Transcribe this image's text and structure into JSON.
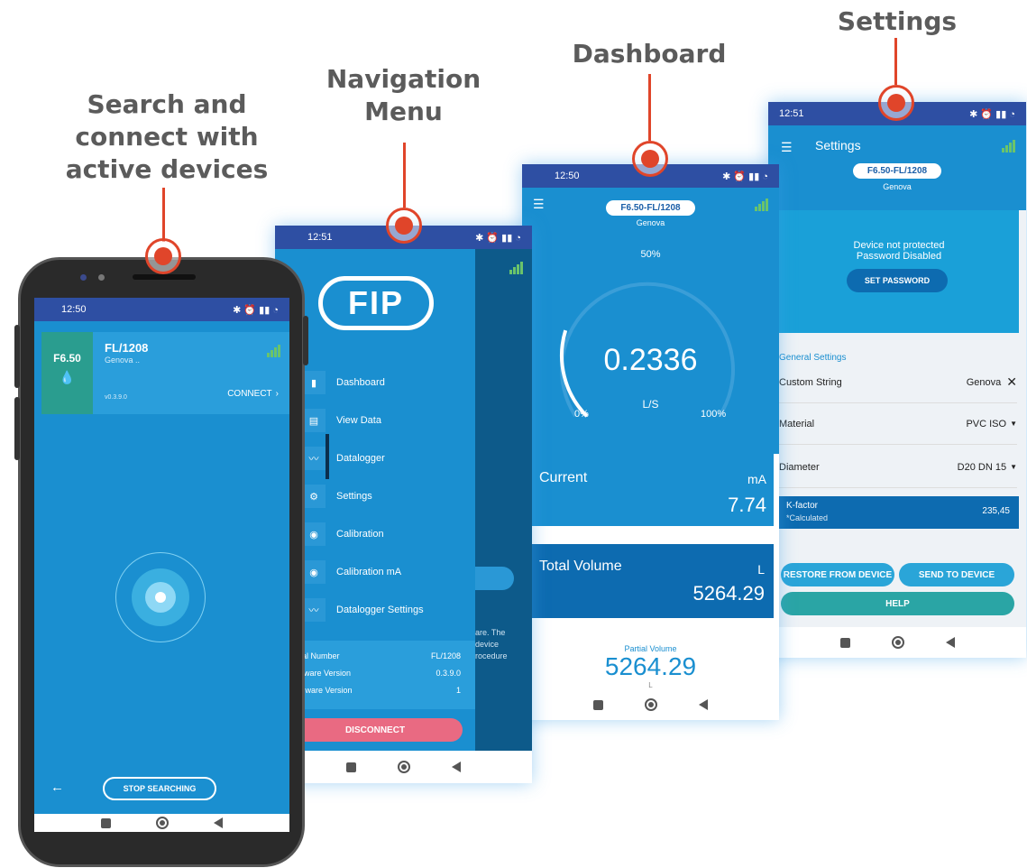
{
  "captions": {
    "search": "Search and connect with active devices",
    "menu": "Navigation Menu",
    "dashboard": "Dashboard",
    "settings": "Settings"
  },
  "colors": {
    "accent": "#e0452a",
    "brand": "#1a8fd0",
    "status_bar": "#2e4fa3",
    "dark_blue": "#0d6bb0",
    "pink": "#e96a82",
    "teal": "#2aa5a5"
  },
  "search_screen": {
    "time": "12:50",
    "device_model": "F6.50",
    "device_name": "FL/1208",
    "device_location": "Genova ..",
    "firmware": "v0.3.9.0",
    "connect_label": "CONNECT",
    "stop_label": "STOP SEARCHING"
  },
  "menu_screen": {
    "time": "12:51",
    "logo_text": "FIP",
    "items": [
      "Dashboard",
      "View Data",
      "Datalogger",
      "Settings",
      "Calibration",
      "Calibration mA",
      "Datalogger Settings"
    ],
    "info": [
      {
        "label": "Serial Number",
        "value": "FL/1208"
      },
      {
        "label": "Firmware Version",
        "value": "0.3.9.0"
      },
      {
        "label": "Hardware Version",
        "value": "1"
      }
    ],
    "bg_text": [
      "are. The",
      "device",
      "rocedure"
    ],
    "disconnect_label": "DISCONNECT"
  },
  "dashboard_screen": {
    "time": "12:50",
    "device_tag": "F6.50-FL/1208",
    "location": "Genova",
    "gauge_mid": "50%",
    "gauge_value": "0.2336",
    "gauge_unit": "L/S",
    "gauge_min": "0%",
    "gauge_max": "100%",
    "gauge_fraction": 0.23,
    "current_label": "Current",
    "current_unit": "mA",
    "current_value": "7.74",
    "total_label": "Total Volume",
    "total_unit": "L",
    "total_value": "5264.29",
    "partial_label": "Partial Volume",
    "partial_value": "5264.29",
    "partial_unit": "L"
  },
  "settings_screen": {
    "time": "12:51",
    "title": "Settings",
    "device_tag": "F6.50-FL/1208",
    "location": "Genova",
    "protect_line1": "Device not protected",
    "protect_line2": "Password Disabled",
    "set_password_label": "SET PASSWORD",
    "section_title": "General Settings",
    "rows": [
      {
        "label": "Custom String",
        "value": "Genova"
      },
      {
        "label": "Material",
        "value": "PVC ISO"
      },
      {
        "label": "Diameter",
        "value": "D20 DN 15"
      }
    ],
    "kfactor_label": "K-factor",
    "kfactor_sub": "*Calculated",
    "kfactor_value": "235,45",
    "restore_label": "RESTORE FROM DEVICE",
    "send_label": "SEND TO DEVICE",
    "help_label": "HELP"
  }
}
